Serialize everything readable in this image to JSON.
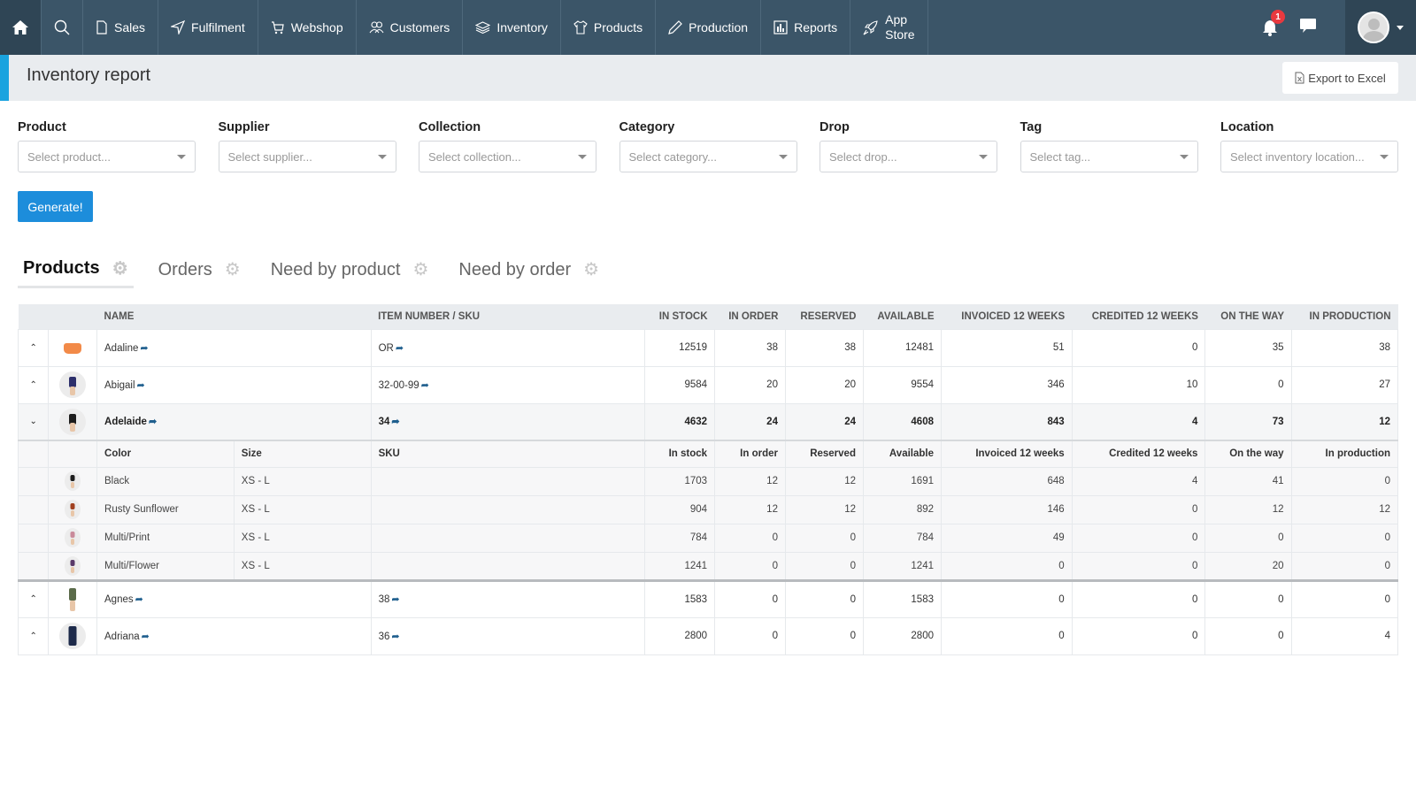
{
  "nav": {
    "items": [
      {
        "label": "Sales",
        "icon": "document-icon"
      },
      {
        "label": "Fulfilment",
        "icon": "send-icon"
      },
      {
        "label": "Webshop",
        "icon": "cart-icon"
      },
      {
        "label": "Customers",
        "icon": "users-icon"
      },
      {
        "label": "Inventory",
        "icon": "layers-icon"
      },
      {
        "label": "Products",
        "icon": "tshirt-icon"
      },
      {
        "label": "Production",
        "icon": "pencil-icon"
      },
      {
        "label": "Reports",
        "icon": "bar-chart-icon"
      }
    ],
    "app_store": {
      "line1": "App",
      "line2": "Store"
    },
    "notification_count": "1"
  },
  "header": {
    "title": "Inventory report",
    "export_label": "Export to Excel"
  },
  "filters": [
    {
      "label": "Product",
      "placeholder": "Select product..."
    },
    {
      "label": "Supplier",
      "placeholder": "Select supplier..."
    },
    {
      "label": "Collection",
      "placeholder": "Select collection..."
    },
    {
      "label": "Category",
      "placeholder": "Select category..."
    },
    {
      "label": "Drop",
      "placeholder": "Select drop..."
    },
    {
      "label": "Tag",
      "placeholder": "Select tag..."
    },
    {
      "label": "Location",
      "placeholder": "Select inventory location..."
    }
  ],
  "generate_label": "Generate!",
  "tabs": [
    {
      "label": "Products",
      "active": true
    },
    {
      "label": "Orders",
      "active": false
    },
    {
      "label": "Need by product",
      "active": false
    },
    {
      "label": "Need by order",
      "active": false
    }
  ],
  "table": {
    "columns": [
      "NAME",
      "ITEM NUMBER / SKU",
      "IN STOCK",
      "IN ORDER",
      "RESERVED",
      "AVAILABLE",
      "INVOICED 12 WEEKS",
      "CREDITED 12 WEEKS",
      "ON THE WAY",
      "IN PRODUCTION"
    ],
    "rows": [
      {
        "name": "Adaline",
        "sku": "OR",
        "in_stock": "12519",
        "in_order": "38",
        "reserved": "38",
        "available": "12481",
        "invoiced": "51",
        "credited": "0",
        "on_the_way": "35",
        "in_production": "38"
      },
      {
        "name": "Abigail",
        "sku": "32-00-99",
        "in_stock": "9584",
        "in_order": "20",
        "reserved": "20",
        "available": "9554",
        "invoiced": "346",
        "credited": "10",
        "on_the_way": "0",
        "in_production": "27"
      },
      {
        "name": "Adelaide",
        "sku": "34",
        "in_stock": "4632",
        "in_order": "24",
        "reserved": "24",
        "available": "4608",
        "invoiced": "843",
        "credited": "4",
        "on_the_way": "73",
        "in_production": "12"
      },
      {
        "name": "Agnes",
        "sku": "38",
        "in_stock": "1583",
        "in_order": "0",
        "reserved": "0",
        "available": "1583",
        "invoiced": "0",
        "credited": "0",
        "on_the_way": "0",
        "in_production": "0"
      },
      {
        "name": "Adriana",
        "sku": "36",
        "in_stock": "2800",
        "in_order": "0",
        "reserved": "0",
        "available": "2800",
        "invoiced": "0",
        "credited": "0",
        "on_the_way": "0",
        "in_production": "4"
      }
    ],
    "variant_columns": [
      "Color",
      "Size",
      "SKU",
      "In stock",
      "In order",
      "Reserved",
      "Available",
      "Invoiced 12 weeks",
      "Credited 12 weeks",
      "On the way",
      "In production"
    ],
    "variants": [
      {
        "color": "Black",
        "size": "XS - L",
        "sku": "",
        "in_stock": "1703",
        "in_order": "12",
        "reserved": "12",
        "available": "1691",
        "invoiced": "648",
        "credited": "4",
        "on_the_way": "41",
        "in_production": "0"
      },
      {
        "color": "Rusty Sunflower",
        "size": "XS - L",
        "sku": "",
        "in_stock": "904",
        "in_order": "12",
        "reserved": "12",
        "available": "892",
        "invoiced": "146",
        "credited": "0",
        "on_the_way": "12",
        "in_production": "12"
      },
      {
        "color": "Multi/Print",
        "size": "XS - L",
        "sku": "",
        "in_stock": "784",
        "in_order": "0",
        "reserved": "0",
        "available": "784",
        "invoiced": "49",
        "credited": "0",
        "on_the_way": "0",
        "in_production": "0"
      },
      {
        "color": "Multi/Flower",
        "size": "XS - L",
        "sku": "",
        "in_stock": "1241",
        "in_order": "0",
        "reserved": "0",
        "available": "1241",
        "invoiced": "0",
        "credited": "0",
        "on_the_way": "20",
        "in_production": "0"
      }
    ]
  },
  "colors": {
    "nav_bg": "#3b5568",
    "accent": "#1aa3df",
    "primary_button": "#1d8ddb",
    "badge": "#e8393f",
    "link_arrow": "#1f5f8e"
  }
}
